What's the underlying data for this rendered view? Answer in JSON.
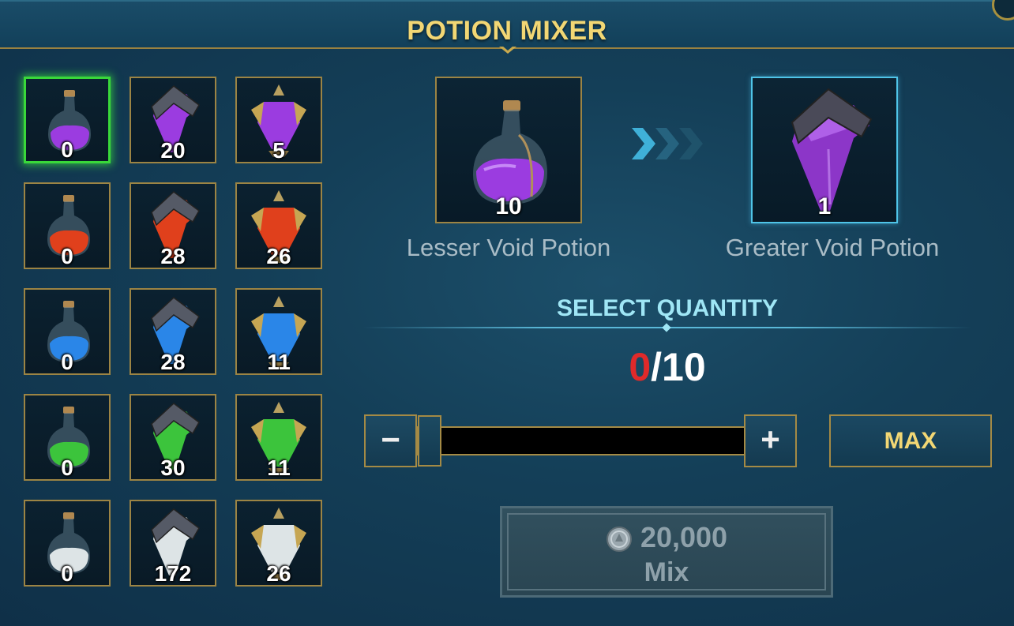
{
  "header": {
    "title": "POTION MIXER"
  },
  "inventory": [
    {
      "name": "lesser-void-potion",
      "color": "#9b3ce0",
      "count": "0",
      "selected": true
    },
    {
      "name": "greater-void-potion",
      "color": "#9b3ce0",
      "count": "20"
    },
    {
      "name": "superior-void-potion",
      "color": "#9b3ce0",
      "count": "5"
    },
    {
      "name": "lesser-force-potion",
      "color": "#e0401c",
      "count": "0"
    },
    {
      "name": "greater-force-potion",
      "color": "#e0401c",
      "count": "28"
    },
    {
      "name": "superior-force-potion",
      "color": "#e0401c",
      "count": "26"
    },
    {
      "name": "lesser-magic-potion",
      "color": "#2a86e8",
      "count": "0"
    },
    {
      "name": "greater-magic-potion",
      "color": "#2a86e8",
      "count": "28"
    },
    {
      "name": "superior-magic-potion",
      "color": "#2a86e8",
      "count": "11"
    },
    {
      "name": "lesser-spirit-potion",
      "color": "#3cc43c",
      "count": "0"
    },
    {
      "name": "greater-spirit-potion",
      "color": "#3cc43c",
      "count": "30"
    },
    {
      "name": "superior-spirit-potion",
      "color": "#3cc43c",
      "count": "11"
    },
    {
      "name": "lesser-arcane-potion",
      "color": "#dde4e6",
      "count": "0"
    },
    {
      "name": "greater-arcane-potion",
      "color": "#dde4e6",
      "count": "172"
    },
    {
      "name": "superior-arcane-potion",
      "color": "#dde4e6",
      "count": "26"
    }
  ],
  "recipe": {
    "input": {
      "name": "Lesser Void Potion",
      "count": "10"
    },
    "output": {
      "name": "Greater Void Potion",
      "count": "1"
    }
  },
  "quantity": {
    "label": "SELECT QUANTITY",
    "current": "0",
    "separator_max": "/10"
  },
  "slider": {
    "minus": "−",
    "plus": "+",
    "max_label": "MAX",
    "level": 0
  },
  "mix": {
    "cost": "20,000",
    "label": "Mix",
    "enabled": false
  },
  "colors": {
    "accent_gold": "#f2d774",
    "accent_cyan": "#9fe6f5",
    "selected_green": "#39d83a",
    "quantity_red": "#e02a2a"
  }
}
